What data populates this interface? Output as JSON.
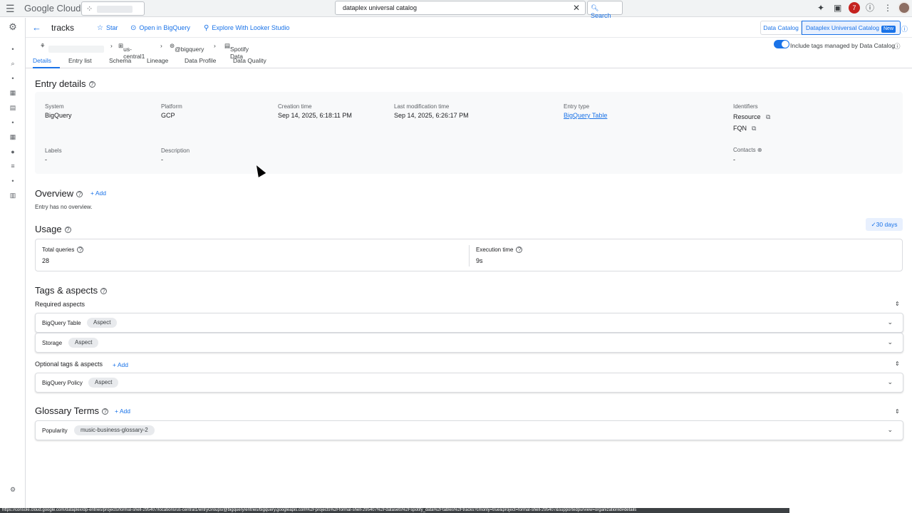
{
  "topbar": {
    "logo": "Google Cloud",
    "search_value": "dataplex universal catalog",
    "search_label": "Search",
    "notif_count": "7"
  },
  "header": {
    "title": "tracks",
    "star": "Star",
    "open_bq": "Open in BigQuery",
    "explore": "Explore With Looker Studio",
    "data_catalog": "Data Catalog",
    "universal": "Dataplex Universal Catalog",
    "new": "New"
  },
  "breadcrumb": {
    "location": "us-central1",
    "group": "@bigquery",
    "dataset": "Spotify Data",
    "toggle_label": "Include tags managed by Data Catalog"
  },
  "tabs": [
    "Details",
    "Entry list",
    "Schema",
    "Lineage",
    "Data Profile",
    "Data Quality"
  ],
  "entry_details": {
    "title": "Entry details",
    "system_label": "System",
    "system": "BigQuery",
    "platform_label": "Platform",
    "platform": "GCP",
    "creation_label": "Creation time",
    "creation": "Sep 14, 2025, 6:18:11 PM",
    "modified_label": "Last modification time",
    "modified": "Sep 14, 2025, 6:26:17 PM",
    "entry_type_label": "Entry type",
    "entry_type": "BigQuery Table",
    "identifiers_label": "Identifiers",
    "resource": "Resource",
    "fqn": "FQN",
    "labels_label": "Labels",
    "labels": "-",
    "description_label": "Description",
    "description": "-",
    "contacts_label": "Contacts",
    "contacts": "-"
  },
  "overview": {
    "title": "Overview",
    "add": "Add",
    "empty": "Entry has no overview."
  },
  "usage": {
    "title": "Usage",
    "range": "30 days",
    "total_label": "Total queries",
    "total": "28",
    "exec_label": "Execution time",
    "exec": "9s"
  },
  "tags": {
    "title": "Tags & aspects",
    "required": "Required aspects",
    "required_rows": [
      {
        "name": "BigQuery Table",
        "chip": "Aspect"
      },
      {
        "name": "Storage",
        "chip": "Aspect"
      }
    ],
    "optional": "Optional tags & aspects",
    "add": "Add",
    "optional_rows": [
      {
        "name": "BigQuery Policy",
        "chip": "Aspect"
      }
    ]
  },
  "glossary": {
    "title": "Glossary Terms",
    "add": "Add",
    "rows": [
      {
        "name": "Popularity",
        "chip": "music-business-glossary-2"
      }
    ]
  },
  "statusbar": "https://console.cloud.google.com/dataplex/dp-entries/projects/formal-shell-295407/locations/us-central1/entryGroups/@bigquery/entries/bigquery.googleapis.com%2Fprojects%2Fformal-shell-295407%2Fdatasets%2Fspotify_data%2Ftables%2Ftracks?cmonly=true&project=formal-shell-295407&supportedpurview=organizationId#details"
}
